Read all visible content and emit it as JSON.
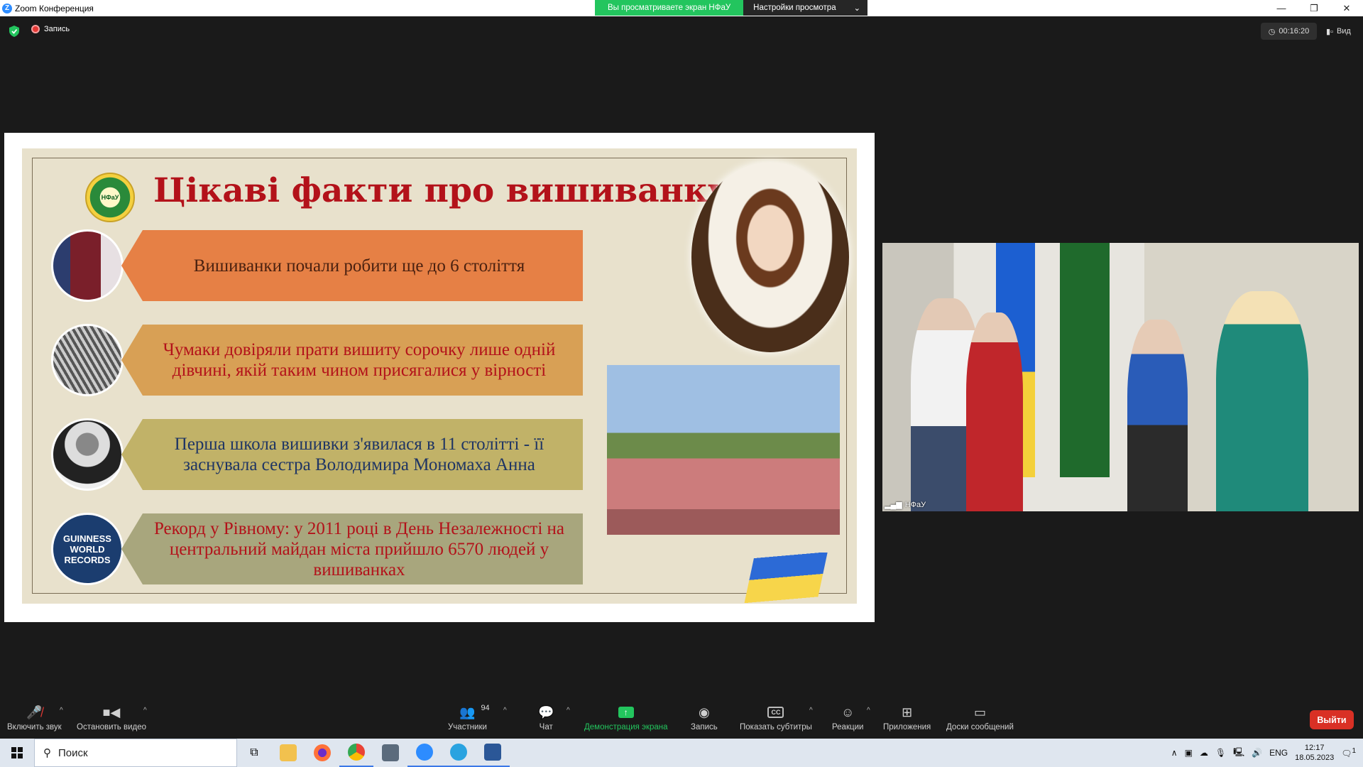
{
  "window": {
    "title": "Zoom Конференция",
    "share_banner": "Вы просматриваете экран НФаУ",
    "view_settings": "Настройки просмотра"
  },
  "meeting": {
    "recording_label": "Запись",
    "timer": "00:16:20",
    "view_label": "Вид"
  },
  "slide": {
    "title": "Цікаві факти про вишиванку",
    "logo_text": "НФаУ",
    "facts": [
      "Вишиванки почали робити ще до 6 століття",
      "Чумаки довіряли прати вишиту сорочку лише одній дівчині, якій таким чином присягалися у вірності",
      "Перша школа вишивки з'явилася в 11 столітті - її заснувала сестра Володимира Мономаха Анна",
      "Рекорд у Рівному: у 2011 році в День Незалежності на центральний майдан міста прийшло 6570 людей у вишиванках"
    ],
    "guinness_text": "GUINNESS WORLD RECORDS"
  },
  "video_tile": {
    "participant_name": "НФаУ"
  },
  "toolbar": {
    "unmute": "Включить звук",
    "stop_video": "Остановить видео",
    "participants": "Участники",
    "participants_count": "94",
    "chat": "Чат",
    "share_screen": "Демонстрация экрана",
    "record": "Запись",
    "captions": "Показать субтитры",
    "reactions": "Реакции",
    "apps": "Приложения",
    "whiteboards": "Доски сообщений",
    "leave": "Выйти"
  },
  "taskbar": {
    "search_placeholder": "Поиск",
    "language": "ENG",
    "time": "12:17",
    "date": "18.05.2023",
    "notification_count": "1"
  },
  "colors": {
    "share_green": "#23c55e",
    "leave_red": "#d93025",
    "title_red": "#b3121a"
  }
}
